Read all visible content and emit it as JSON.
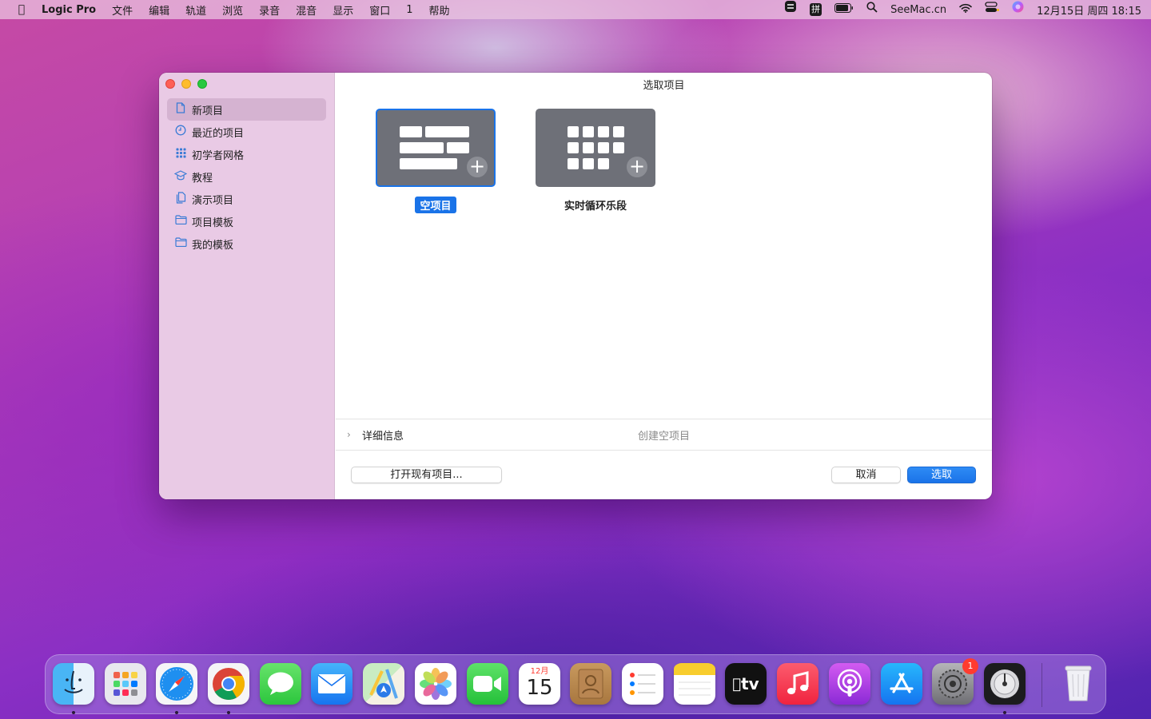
{
  "menubar": {
    "app_name": "Logic Pro",
    "items": [
      "文件",
      "编辑",
      "轨道",
      "浏览",
      "录音",
      "混音",
      "显示",
      "窗口",
      "1",
      "帮助"
    ],
    "right_text": "SeeMac.cn",
    "datetime": "12月15日 周四  18:15",
    "input_method": "拼"
  },
  "window": {
    "title": "选取项目",
    "sidebar": [
      {
        "label": "新项目",
        "icon": "document-icon",
        "selected": true
      },
      {
        "label": "最近的项目",
        "icon": "clock-icon"
      },
      {
        "label": "初学者网格",
        "icon": "grid-icon"
      },
      {
        "label": "教程",
        "icon": "graduation-cap-icon"
      },
      {
        "label": "演示项目",
        "icon": "documents-icon"
      },
      {
        "label": "项目模板",
        "icon": "folder-icon"
      },
      {
        "label": "我的模板",
        "icon": "folder-icon"
      }
    ],
    "tiles": [
      {
        "label": "空项目",
        "selected": true
      },
      {
        "label": "实时循环乐段",
        "selected": false
      }
    ],
    "details_label": "详细信息",
    "details_info": "创建空项目",
    "open_existing": "打开现有项目...",
    "cancel": "取消",
    "choose": "选取"
  },
  "dock": {
    "apps": [
      "Finder",
      "Launchpad",
      "Safari",
      "Chrome",
      "Messages",
      "Mail",
      "Maps",
      "Photos",
      "FaceTime",
      "Calendar",
      "Contacts",
      "Reminders",
      "Notes",
      "TV",
      "Music",
      "Podcasts",
      "App Store",
      "System Preferences",
      "Logic Pro",
      "Trash"
    ],
    "calendar_month": "12月",
    "calendar_day": "15",
    "settings_badge": "1",
    "tv_label": "tv"
  }
}
